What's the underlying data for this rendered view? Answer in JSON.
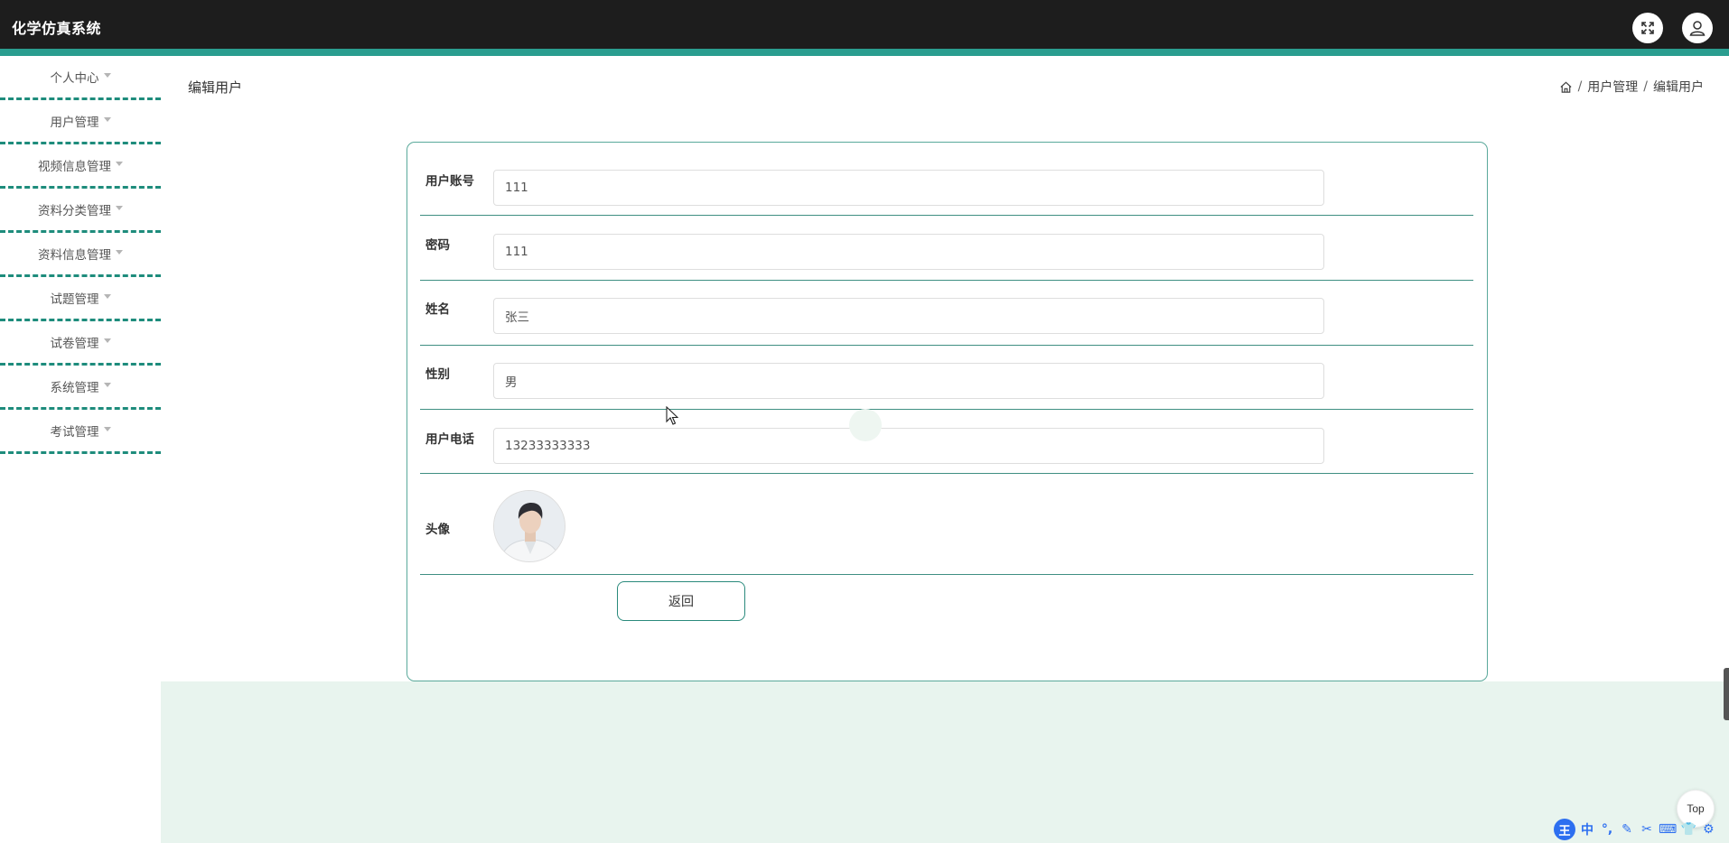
{
  "app": {
    "title": "化学仿真系统"
  },
  "header_icons": {
    "fullscreen": "fullscreen-icon",
    "user": "user-icon"
  },
  "sidebar": {
    "items": [
      {
        "label": "个人中心"
      },
      {
        "label": "用户管理"
      },
      {
        "label": "视频信息管理"
      },
      {
        "label": "资料分类管理"
      },
      {
        "label": "资料信息管理"
      },
      {
        "label": "试题管理"
      },
      {
        "label": "试卷管理"
      },
      {
        "label": "系统管理"
      },
      {
        "label": "考试管理"
      }
    ]
  },
  "page": {
    "title": "编辑用户"
  },
  "breadcrumb": {
    "items": [
      "用户管理",
      "编辑用户"
    ]
  },
  "form": {
    "fields": [
      {
        "label": "用户账号",
        "value": "111"
      },
      {
        "label": "密码",
        "value": "111"
      },
      {
        "label": "姓名",
        "value": "张三"
      },
      {
        "label": "性别",
        "value": "男"
      },
      {
        "label": "用户电话",
        "value": "13233333333"
      }
    ],
    "avatar_label": "头像",
    "back_label": "返回"
  },
  "floating": {
    "top_label": "Top"
  },
  "ime": {
    "logo": "王",
    "items": [
      "中",
      "°,",
      "✎",
      "✂",
      "⌨",
      "👕",
      "⚙"
    ]
  },
  "colors": {
    "topbar": "#1d1d1d",
    "accent": "#2a9d8f",
    "nav_border": "#1e8c7c",
    "band": "#e8f4ee",
    "ime": "#2d6ff0"
  }
}
